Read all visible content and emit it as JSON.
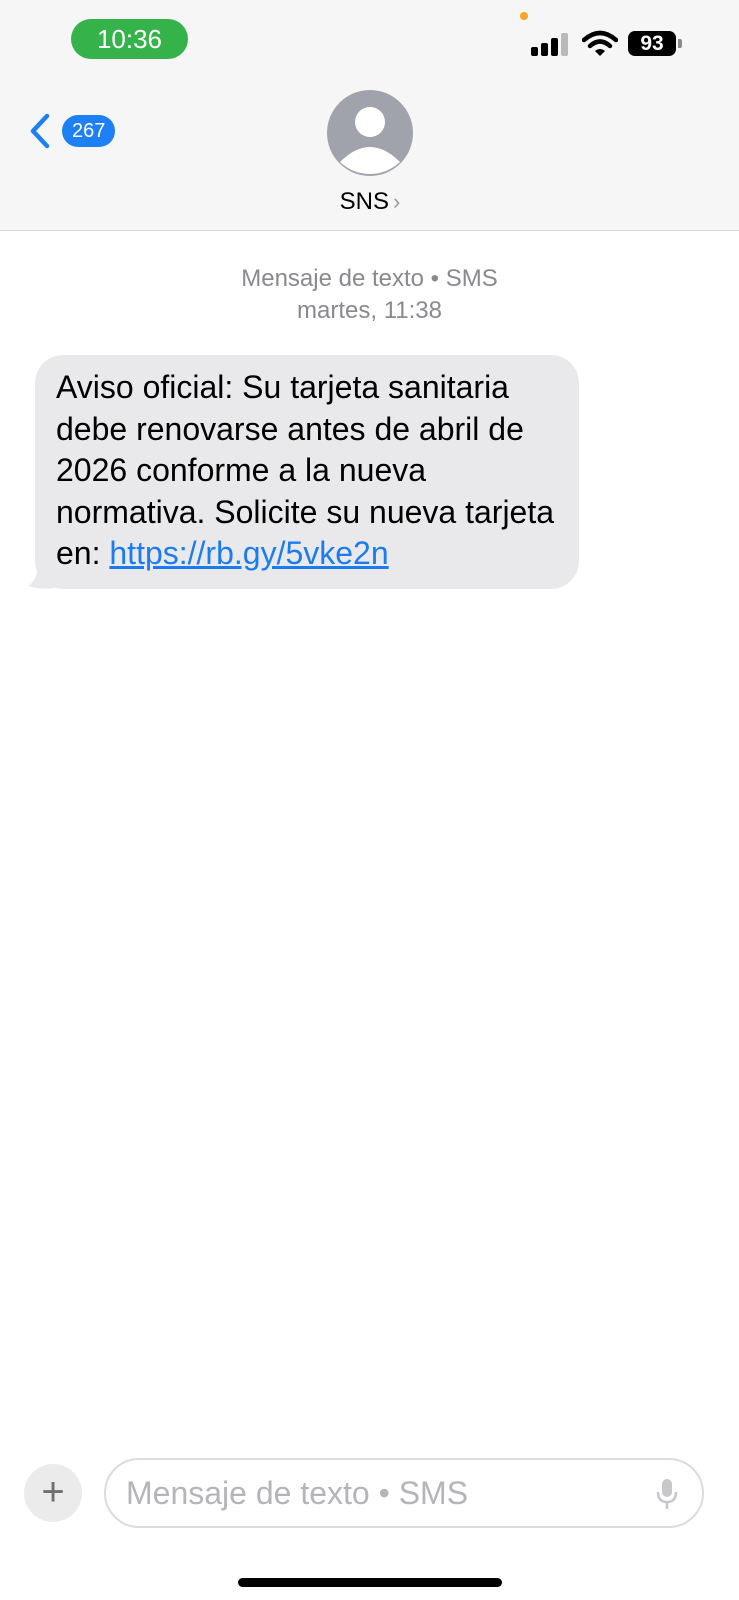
{
  "status_bar": {
    "time": "10:36",
    "battery": "93",
    "signal_bars_active": 3,
    "signal_bars_total": 4
  },
  "header": {
    "back_badge": "267",
    "contact_name": "SNS",
    "contact_chevron": "›"
  },
  "conversation": {
    "meta_service": "Mensaje de texto • SMS",
    "meta_time": "martes, 11:38",
    "message_text": "Aviso oficial: Su tarjeta sanitaria debe renovarse antes de abril de 2026 conforme a la nueva normativa. Solicite su nueva tarjeta en: ",
    "message_link": "https://rb.gy/5vke2n"
  },
  "composer": {
    "plus_label": "+",
    "placeholder": "Mensaje de texto • SMS"
  },
  "colors": {
    "accent": "#1d80f5",
    "time_pill": "#35b34a",
    "bubble": "#e9e9eb",
    "link": "#1b7cf2"
  },
  "icons": [
    "back-chevron-icon",
    "contact-avatar-icon",
    "signal-icon",
    "wifi-icon",
    "battery-icon",
    "plus-icon",
    "microphone-icon"
  ]
}
